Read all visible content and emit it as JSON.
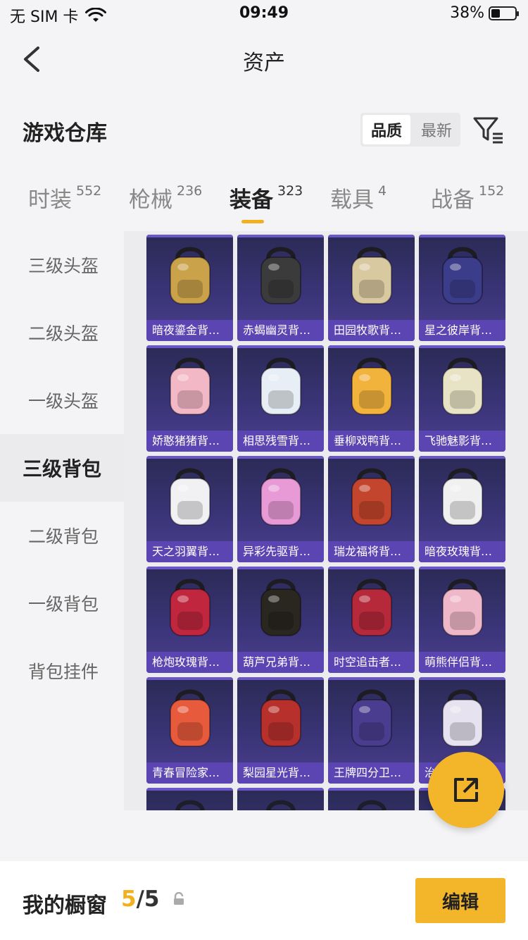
{
  "status": {
    "carrier": "无 SIM 卡",
    "time": "09:49",
    "battery": "38%",
    "battery_level": 0.38
  },
  "nav": {
    "title": "资产"
  },
  "warehouse": {
    "title": "游戏仓库",
    "sort_options": [
      "品质",
      "最新"
    ],
    "sort_selected": "品质"
  },
  "tabs": [
    {
      "label": "时装",
      "count": "552"
    },
    {
      "label": "枪械",
      "count": "236"
    },
    {
      "label": "装备",
      "count": "323"
    },
    {
      "label": "载具",
      "count": "4"
    },
    {
      "label": "战备",
      "count": "152"
    }
  ],
  "active_tab": "装备",
  "sidebar": {
    "items": [
      "三级头盔",
      "二级头盔",
      "一级头盔",
      "三级背包",
      "二级背包",
      "一级背包",
      "背包挂件"
    ],
    "active": "三级背包"
  },
  "items": [
    {
      "name": "暗夜鎏金背…",
      "color": "#c9a24a"
    },
    {
      "name": "赤蝎幽灵背…",
      "color": "#3b3b3b"
    },
    {
      "name": "田园牧歌背…",
      "color": "#d9c9a0"
    },
    {
      "name": "星之彼岸背…",
      "color": "#3c3d8a"
    },
    {
      "name": "娇憨猪猪背…",
      "color": "#f3b8c6"
    },
    {
      "name": "相思残雪背…",
      "color": "#e8eef5"
    },
    {
      "name": "垂柳戏鸭背…",
      "color": "#f2b33d"
    },
    {
      "name": "飞驰魅影背…",
      "color": "#e9e3c6"
    },
    {
      "name": "天之羽翼背…",
      "color": "#f1f1f4"
    },
    {
      "name": "异彩先驱背…",
      "color": "#e89ad6"
    },
    {
      "name": "瑞龙福将背…",
      "color": "#c4452d"
    },
    {
      "name": "暗夜玫瑰背…",
      "color": "#f0f0f0"
    },
    {
      "name": "枪炮玫瑰背…",
      "color": "#c0263e"
    },
    {
      "name": "葫芦兄弟背…",
      "color": "#2a2620"
    },
    {
      "name": "时空追击者…",
      "color": "#b6293b"
    },
    {
      "name": "萌熊伴侣背…",
      "color": "#efb8c8"
    },
    {
      "name": "青春冒险家…",
      "color": "#e85a3c"
    },
    {
      "name": "梨园星光背…",
      "color": "#b8302c"
    },
    {
      "name": "王牌四分卫…",
      "color": "#4a3d8f"
    },
    {
      "name": "治…",
      "color": "#e6e2ef"
    }
  ],
  "partial_row_colors": [
    "#3ec58a",
    "#c8c05a",
    "#9a9aa6",
    "#7a7a86"
  ],
  "showcase": {
    "label": "我的橱窗",
    "current": "5",
    "sep_total": "/5"
  },
  "edit_label": "编辑"
}
